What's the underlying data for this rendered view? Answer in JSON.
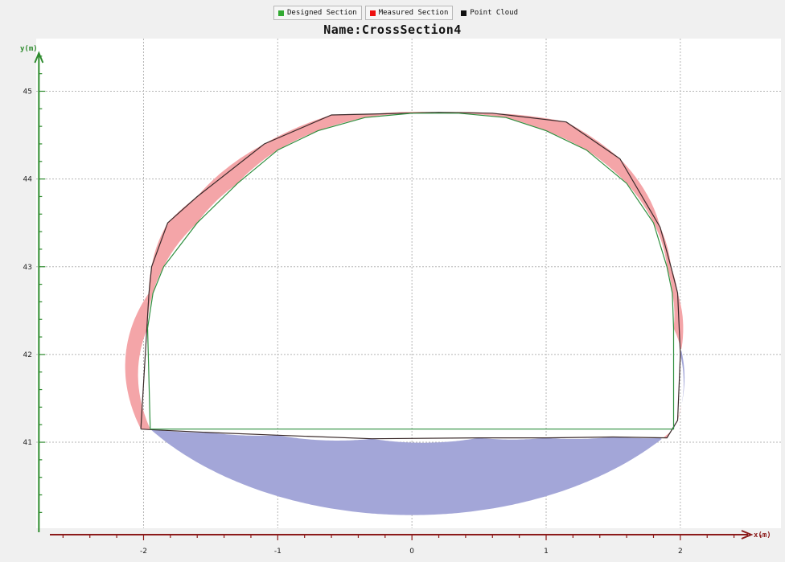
{
  "legend": [
    {
      "label": "Designed Section",
      "color": "#33aa33",
      "active": true
    },
    {
      "label": "Measured Section",
      "color": "#ee1111",
      "active": true
    },
    {
      "label": "Point Cloud",
      "color": "#111111",
      "active": false
    }
  ],
  "chart_data": {
    "type": "area",
    "title": "Name:CrossSection4",
    "xlabel": "x(m)",
    "ylabel": "y(m)",
    "xlim": [
      -2.8,
      2.75
    ],
    "ylim": [
      40.02,
      45.6
    ],
    "grid": true,
    "x_ticks": [
      -2,
      -1,
      0,
      1,
      2
    ],
    "y_ticks": [
      41,
      42,
      43,
      44,
      45
    ],
    "axis_colors": {
      "x": "#8b1a1a",
      "y": "#2e8b2e"
    },
    "fill_colors": {
      "overbreak": "#f4a5a8",
      "underbreak": "#a3a6d8"
    },
    "series": [
      {
        "name": "Designed Section",
        "color": "#2f8f3f",
        "points": [
          [
            -1.95,
            41.15
          ],
          [
            -1.97,
            42.3
          ],
          [
            -1.93,
            42.7
          ],
          [
            -1.85,
            43.0
          ],
          [
            -1.6,
            43.5
          ],
          [
            -1.3,
            43.95
          ],
          [
            -1.0,
            44.33
          ],
          [
            -0.7,
            44.55
          ],
          [
            -0.35,
            44.7
          ],
          [
            0.0,
            44.75
          ],
          [
            0.35,
            44.75
          ],
          [
            0.7,
            44.7
          ],
          [
            1.0,
            44.55
          ],
          [
            1.3,
            44.33
          ],
          [
            1.6,
            43.95
          ],
          [
            1.8,
            43.5
          ],
          [
            1.9,
            43.0
          ],
          [
            1.94,
            42.7
          ],
          [
            1.95,
            42.3
          ],
          [
            1.95,
            41.15
          ],
          [
            -1.95,
            41.15
          ]
        ]
      },
      {
        "name": "Measured Section",
        "color": "#3a2a2a",
        "points": [
          [
            -2.02,
            41.15
          ],
          [
            -1.9,
            41.14
          ],
          [
            -1.5,
            41.11
          ],
          [
            -1.0,
            41.08
          ],
          [
            -0.3,
            41.04
          ],
          [
            0.5,
            41.05
          ],
          [
            1.0,
            41.05
          ],
          [
            1.5,
            41.06
          ],
          [
            1.9,
            41.05
          ],
          [
            1.98,
            41.25
          ],
          [
            2.0,
            42.0
          ],
          [
            1.98,
            42.7
          ],
          [
            1.93,
            43.0
          ],
          [
            1.85,
            43.45
          ],
          [
            1.55,
            44.23
          ],
          [
            1.15,
            44.65
          ],
          [
            0.6,
            44.75
          ],
          [
            0.2,
            44.76
          ],
          [
            -0.3,
            44.74
          ],
          [
            -0.6,
            44.73
          ],
          [
            -1.1,
            44.4
          ],
          [
            -1.6,
            43.8
          ],
          [
            -1.82,
            43.5
          ],
          [
            -1.94,
            43.0
          ],
          [
            -1.96,
            42.7
          ],
          [
            -2.02,
            41.15
          ]
        ]
      },
      {
        "name": "Point Cloud",
        "color": "#111111",
        "points": []
      }
    ]
  }
}
